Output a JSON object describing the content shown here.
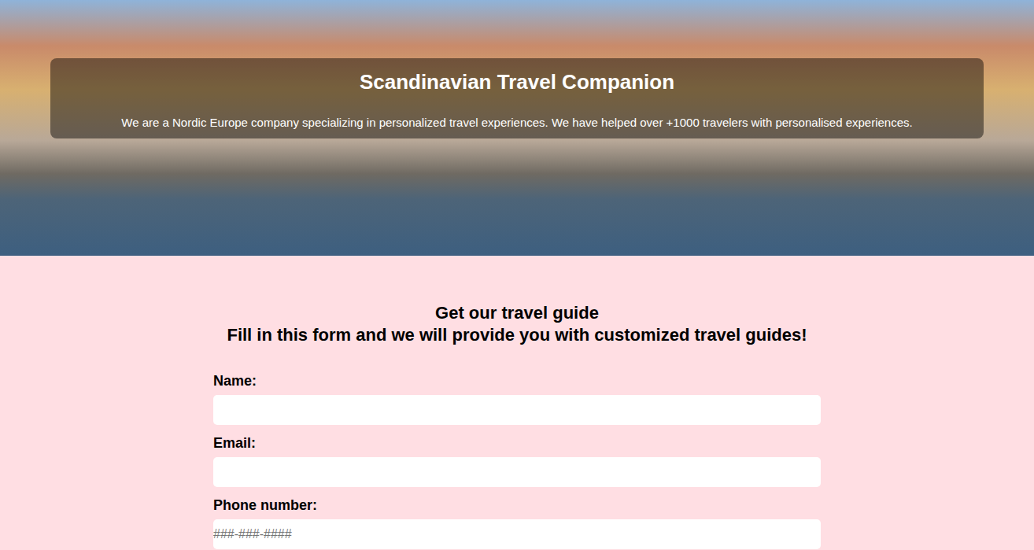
{
  "hero": {
    "title": "Scandinavian Travel Companion",
    "subtitle": "We are a Nordic Europe company specializing in personalized travel experiences. We have helped over +1000 travelers with personalised experiences."
  },
  "form": {
    "heading": [
      "Get our travel guide",
      "Fill in this form and we will provide you with customized travel guides!"
    ],
    "fields": [
      {
        "label": "Name:",
        "placeholder": ""
      },
      {
        "label": "Email:",
        "placeholder": ""
      },
      {
        "label": "Phone number:",
        "placeholder": "###-###-####"
      }
    ]
  }
}
